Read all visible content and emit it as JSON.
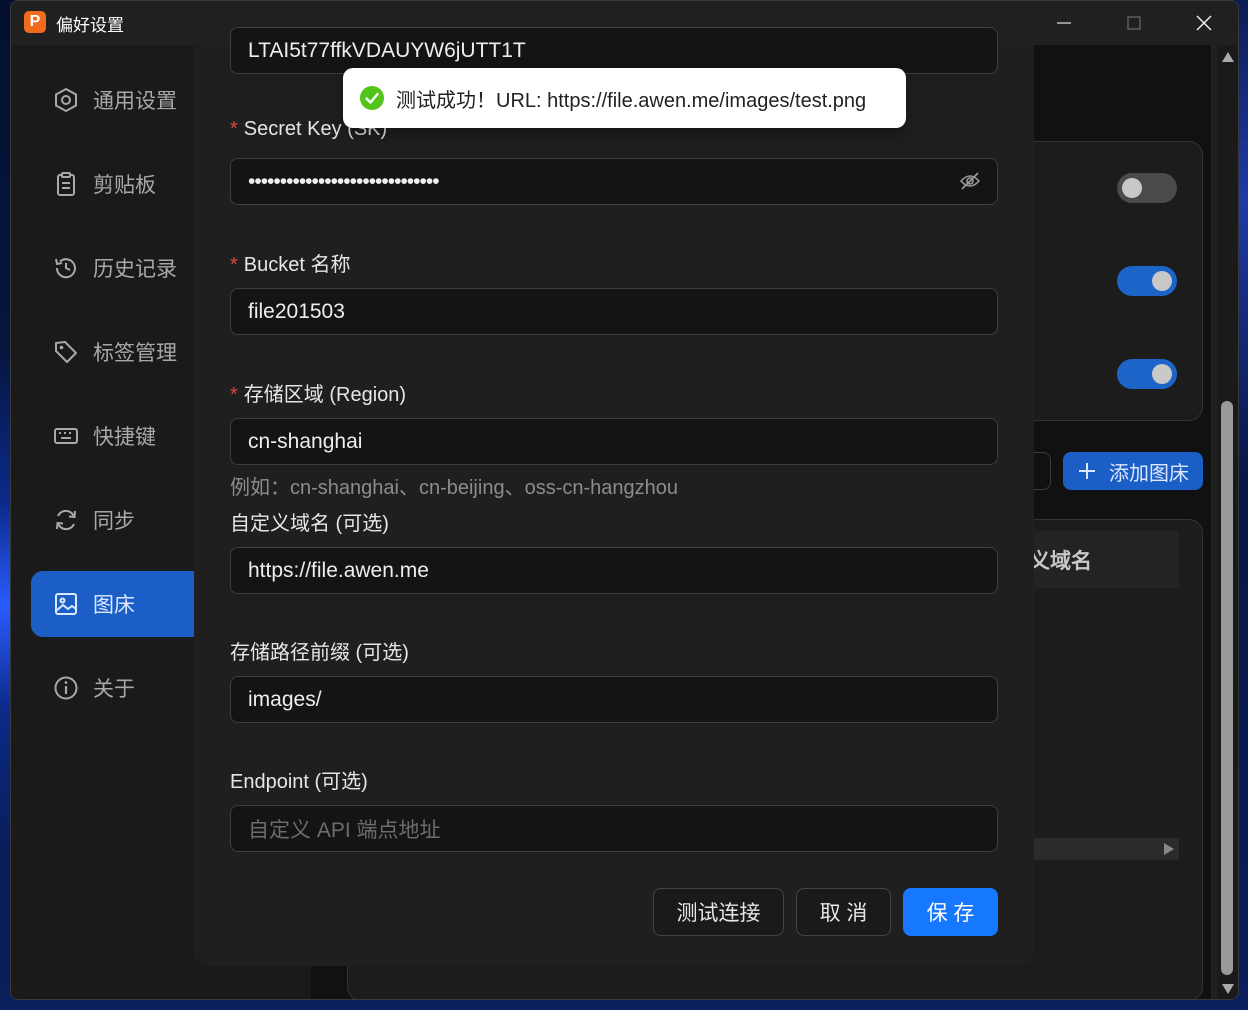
{
  "window": {
    "title": "偏好设置",
    "logo_letter": "P"
  },
  "sidebar": {
    "items": [
      {
        "label": "通用设置"
      },
      {
        "label": "剪贴板"
      },
      {
        "label": "历史记录"
      },
      {
        "label": "标签管理"
      },
      {
        "label": "快捷键"
      },
      {
        "label": "同步"
      },
      {
        "label": "图床",
        "active": true
      },
      {
        "label": "关于"
      }
    ]
  },
  "background": {
    "add_button_label": "添加图床",
    "table_header": "义域名",
    "toggles": [
      "off",
      "on",
      "on"
    ]
  },
  "toast": {
    "message": "测试成功！URL: https://file.awen.me/images/test.png",
    "type": "success"
  },
  "form": {
    "access_key_value": "LTAI5t77ffkVDAUYW6jUTT1T",
    "secret_key": {
      "label": "Secret Key (SK)",
      "required": true,
      "value": "••••••••••••••••••••••••••••••"
    },
    "bucket": {
      "label": "Bucket 名称",
      "required": true,
      "value": "file201503"
    },
    "region": {
      "label": "存储区域 (Region)",
      "required": true,
      "value": "cn-shanghai",
      "hint": "例如：cn-shanghai、cn-beijing、oss-cn-hangzhou"
    },
    "custom_domain": {
      "label": "自定义域名 (可选)",
      "value": "https://file.awen.me"
    },
    "path_prefix": {
      "label": "存储路径前缀 (可选)",
      "value": "images/"
    },
    "endpoint": {
      "label": "Endpoint (可选)",
      "value": "",
      "placeholder": "自定义 API 端点地址"
    },
    "buttons": {
      "test": "测试连接",
      "cancel": "取 消",
      "save": "保 存"
    }
  },
  "colors": {
    "primary": "#1677ff",
    "active_nav": "#1b5fc6",
    "required": "#e0443e",
    "success": "#52c41a"
  }
}
